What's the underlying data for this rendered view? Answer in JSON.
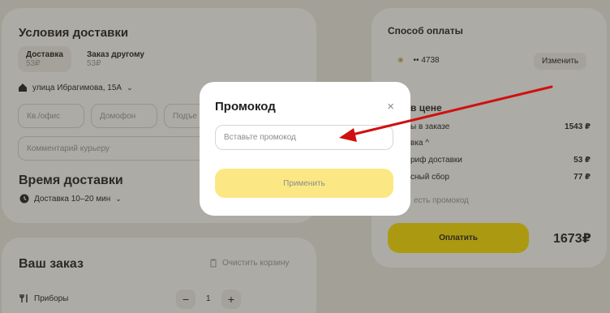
{
  "delivery": {
    "title": "Условия доставки",
    "options": [
      {
        "label": "Доставка",
        "price": "53₽"
      },
      {
        "label": "Заказ другому",
        "price": "53₽"
      }
    ],
    "address": "улица Ибрагимова, 15А",
    "fields": {
      "apartment": "Кв./офис",
      "intercom": "Домофон",
      "entrance": "Подъе",
      "comment": "Комментарий курьеру"
    },
    "time_title": "Время доставки",
    "time_value": "Доставка 10–20 мин"
  },
  "order": {
    "title": "Ваш заказ",
    "clear": "Очистить корзину",
    "cutlery_label": "Приборы",
    "cutlery_qty": "1",
    "minus": "−",
    "plus": "+"
  },
  "payment": {
    "title": "Способ оплаты",
    "card": "•• 4738",
    "change": "Изменить",
    "price_title": "в цене",
    "rows": [
      {
        "label": "ы в заказе",
        "value": "1543 ₽"
      },
      {
        "label": "вка ^",
        "value": ""
      },
      {
        "label": "риф доставки",
        "value": "53 ₽"
      },
      {
        "label": "сный сбор",
        "value": "77 ₽"
      }
    ],
    "promo_hint": "есть промокод",
    "pay_button": "Оплатить",
    "total": "1673₽"
  },
  "modal": {
    "title": "Промокод",
    "close": "×",
    "placeholder": "Вставьте промокод",
    "apply": "Применить"
  },
  "colors": {
    "accent": "#fce000",
    "arrow": "#d01010"
  },
  "icons": {
    "home": "home-icon",
    "clock": "clock-icon",
    "trash": "trash-icon",
    "cutlery": "cutlery-icon",
    "card": "card-logo-icon"
  }
}
